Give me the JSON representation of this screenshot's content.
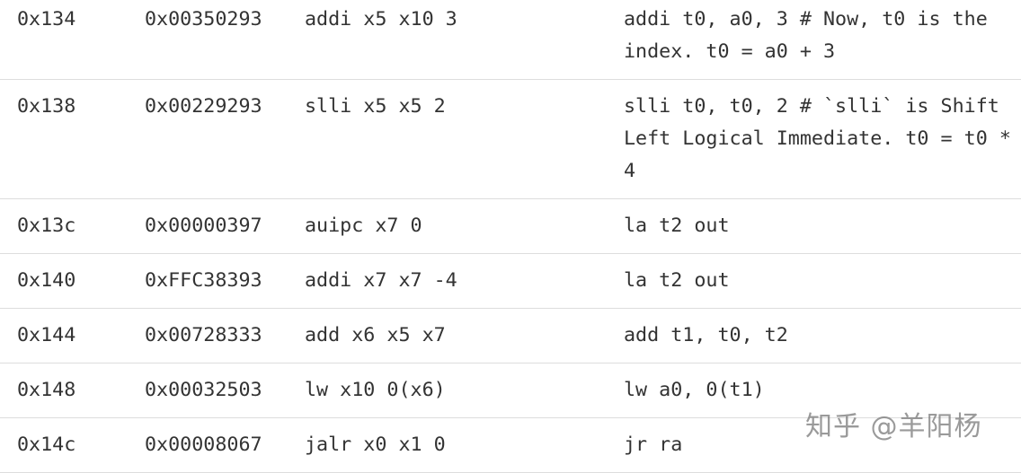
{
  "rows": [
    {
      "address": "0x134",
      "machine_code": "0x00350293",
      "basic": "addi x5 x10 3",
      "source": "addi t0, a0, 3 # Now, t0 is the index. t0 = a0 + 3"
    },
    {
      "address": "0x138",
      "machine_code": "0x00229293",
      "basic": "slli x5 x5 2",
      "source": "slli t0, t0, 2 # `slli` is Shift Left Logical Immediate. t0 = t0 * 4"
    },
    {
      "address": "0x13c",
      "machine_code": "0x00000397",
      "basic": "auipc x7 0",
      "source": "la t2 out"
    },
    {
      "address": "0x140",
      "machine_code": "0xFFC38393",
      "basic": "addi x7 x7 -4",
      "source": "la t2 out"
    },
    {
      "address": "0x144",
      "machine_code": "0x00728333",
      "basic": "add x6 x5 x7",
      "source": "add t1, t0, t2"
    },
    {
      "address": "0x148",
      "machine_code": "0x00032503",
      "basic": "lw x10 0(x6)",
      "source": "lw a0, 0(t1)"
    },
    {
      "address": "0x14c",
      "machine_code": "0x00008067",
      "basic": "jalr x0 x1 0",
      "source": "jr ra"
    }
  ],
  "watermark": "知乎 @羊阳杨"
}
